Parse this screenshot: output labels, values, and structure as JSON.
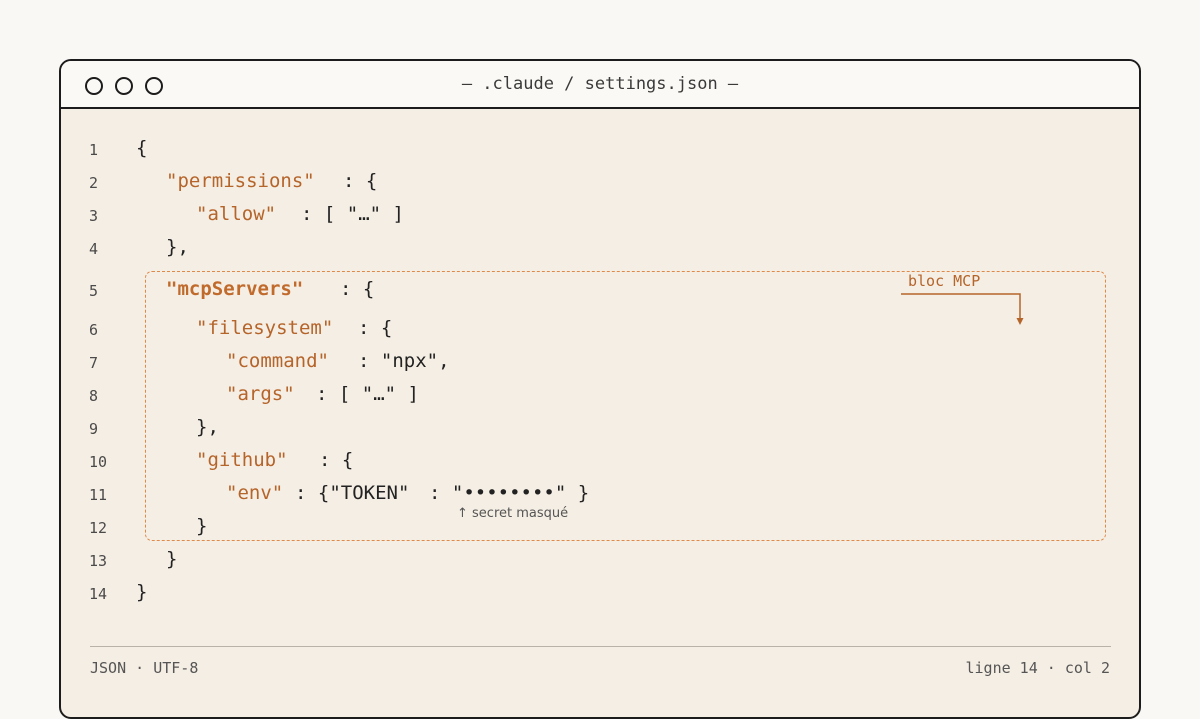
{
  "window": {
    "title": "— .claude / settings.json —"
  },
  "editor": {
    "line_numbers": [
      "1",
      "2",
      "3",
      "4",
      "5",
      "6",
      "7",
      "8",
      "9",
      "10",
      "11",
      "12",
      "13",
      "14"
    ],
    "tokens": {
      "l1_brace": "{",
      "l2_key": "\"permissions\"",
      "l2_rest": ": {",
      "l3_key": "\"allow\"",
      "l3_rest": ": [ \"…\" ]",
      "l4_close": "},",
      "l5_key": "\"mcpServers\"",
      "l5_rest": ": {",
      "l6_key": "\"filesystem\"",
      "l6_rest": ": {",
      "l7_key": "\"command\"",
      "l7_rest": ": \"npx\",",
      "l8_key": "\"args\"",
      "l8_rest": ": [ \"…\" ]",
      "l9_close": "},",
      "l10_key": "\"github\"",
      "l10_rest": ": {",
      "l11_key": "\"env\"",
      "l11_mid": ": {\"TOKEN\"",
      "l11_rest": ": \"••••••••\" }",
      "l12_close": "}",
      "l13_close": "}",
      "l14_close": "}"
    },
    "annotations": {
      "mcp_block_label": "bloc MCP",
      "secret_note": "↑ secret masqué"
    }
  },
  "statusbar": {
    "left": "JSON · UTF-8",
    "right": "ligne 14 · col 2"
  },
  "colors": {
    "key": "#b5642a",
    "dashed_box": "#e08a4a",
    "background": "#f5eee4"
  }
}
